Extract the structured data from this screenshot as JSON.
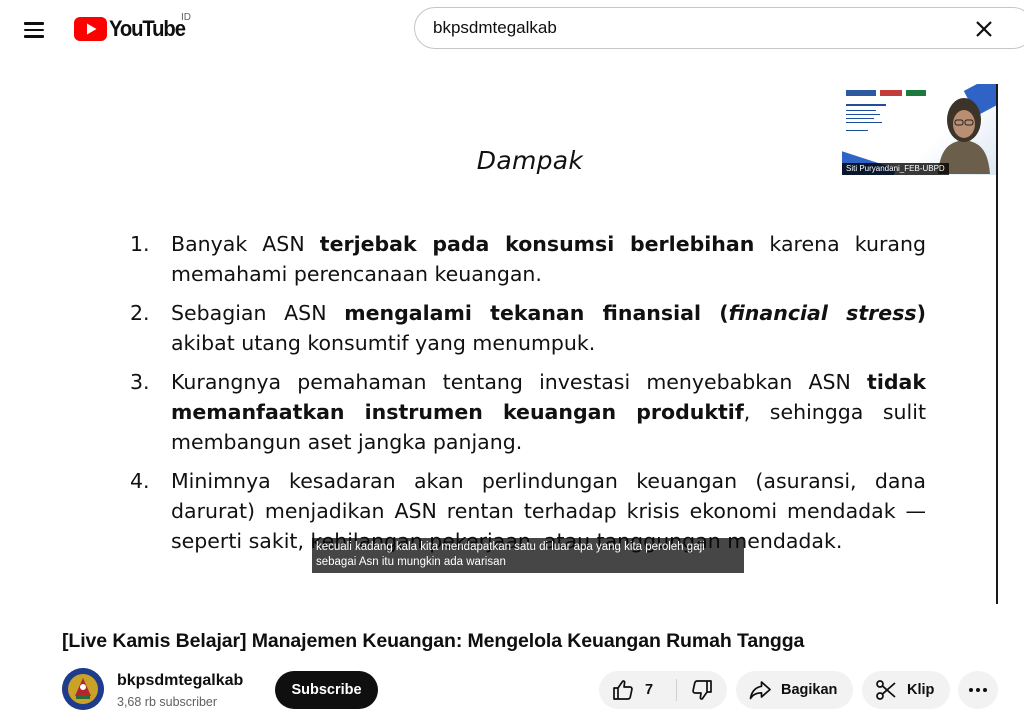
{
  "header": {
    "logo_text": "YouTube",
    "country_code": "ID",
    "search_value": "bkpsdmtegalkab"
  },
  "video": {
    "slide": {
      "title": "Dampak",
      "items": [
        {
          "num": "1.",
          "parts": [
            {
              "text": "Banyak ASN "
            },
            {
              "text": "terjebak pada konsumsi berlebihan",
              "b": true
            },
            {
              "text": " karena kurang memahami perencanaan keuangan."
            }
          ]
        },
        {
          "num": "2.",
          "parts": [
            {
              "text": "Sebagian ASN "
            },
            {
              "text": "mengalami tekanan finansial (",
              "b": true
            },
            {
              "text": "financial stress",
              "b": true,
              "i": true
            },
            {
              "text": ")",
              "b": true
            },
            {
              "text": " akibat utang konsumtif yang menumpuk."
            }
          ]
        },
        {
          "num": "3.",
          "parts": [
            {
              "text": "Kurangnya pemahaman tentang investasi menyebabkan ASN "
            },
            {
              "text": "tidak memanfaatkan instrumen keuangan produktif",
              "b": true
            },
            {
              "text": ", sehingga sulit membangun aset jangka panjang."
            }
          ]
        },
        {
          "num": "4.",
          "parts": [
            {
              "text": "Minimnya kesadaran akan perlindungan keuangan (asuransi, dana darurat) menjadikan ASN rentan terhadap krisis ekonomi mendadak — seperti sakit, kehilangan pekerjaan, atau tanggungan mendadak."
            }
          ]
        }
      ]
    },
    "webcam_name": "Siti Puryandani_FEB-UBPD",
    "caption_lines": [
      "kecuali kadang kala kita mendapatkan satu di luar apa yang kita peroleh gaji",
      "sebagai Asn itu mungkin ada warisan"
    ]
  },
  "details": {
    "title": "[Live Kamis Belajar] Manajemen Keuangan: Mengelola Keuangan Rumah Tangga",
    "channel_name": "bkpsdmtegalkab",
    "subscriber_count": "3,68 rb subscriber",
    "subscribe_label": "Subscribe",
    "like_count": "7",
    "share_label": "Bagikan",
    "clip_label": "Klip"
  },
  "colors": {
    "brand_red": "#ff0000",
    "subscribe_bg": "#0f0f0f",
    "pill_bg": "#f2f2f2"
  },
  "icons": [
    "menu-icon",
    "youtube-logo-icon",
    "close-icon",
    "like-icon",
    "dislike-icon",
    "share-icon",
    "scissors-icon",
    "more-icon"
  ]
}
